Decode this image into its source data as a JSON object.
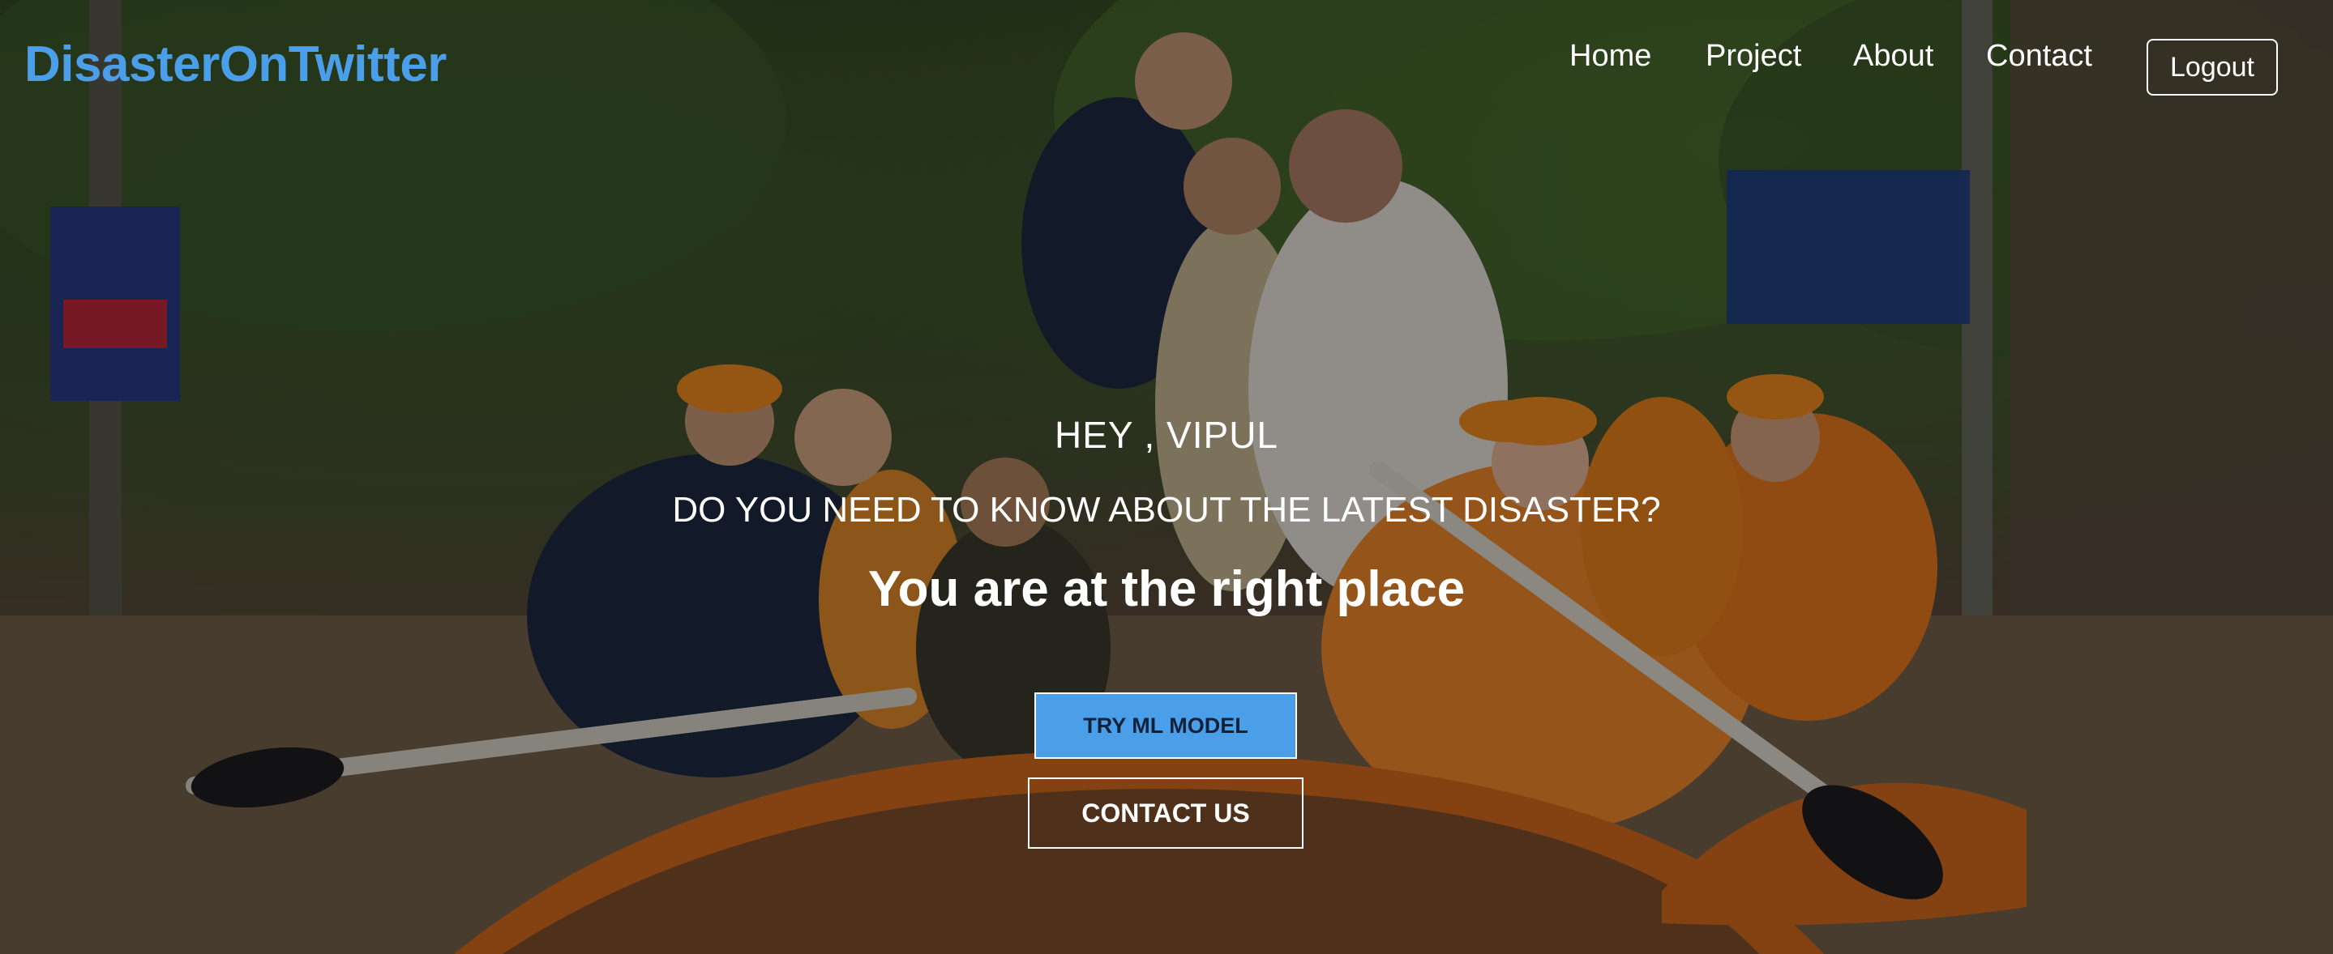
{
  "brand": {
    "name": "DisasterOnTwitter",
    "color": "#4b9fe8"
  },
  "nav": {
    "links": [
      {
        "label": "Home"
      },
      {
        "label": "Project"
      },
      {
        "label": "About"
      },
      {
        "label": "Contact"
      }
    ],
    "logout_label": "Logout"
  },
  "hero": {
    "greeting": "HEY , VIPUL",
    "question": "DO YOU NEED TO KNOW ABOUT THE LATEST DISASTER?",
    "tagline": "You are at the right place",
    "primary_button": "TRY ML MODEL",
    "secondary_button": "CONTACT US",
    "background_image": "flood-rescue-boat-photo"
  },
  "colors": {
    "accent": "#4b9fe8",
    "text": "#ffffff"
  }
}
